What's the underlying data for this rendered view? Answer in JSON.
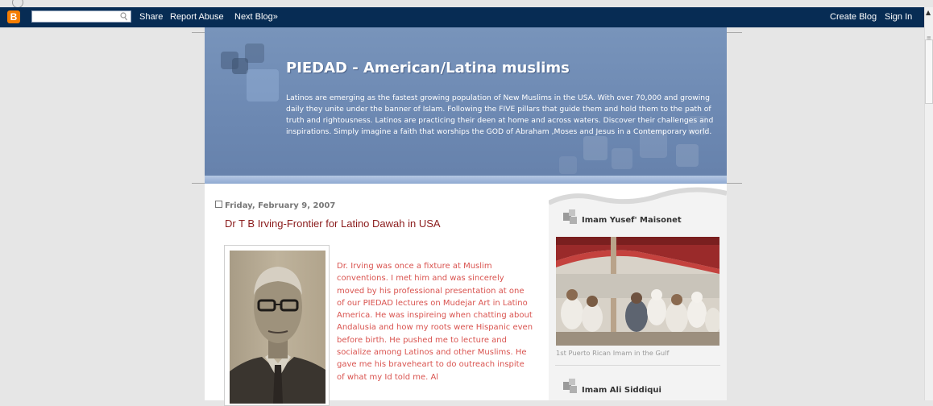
{
  "navbar": {
    "logo": "B",
    "links_left": [
      "Share",
      "Report Abuse",
      "Next Blog»"
    ],
    "links_right": [
      "Create Blog",
      "Sign In"
    ],
    "search_placeholder": ""
  },
  "header": {
    "title": "PIEDAD - American/Latina muslims",
    "description": "Latinos are emerging as the fastest growing population of New Muslims in the USA. With over 70,000 and growing daily they unite under the banner of Islam. Following the FIVE pillars that guide them and hold them to the path of truth and rightousness. Latinos are practicing their deen at home and across waters. Discover their challenges and inspirations. Simply imagine a faith that worships the GOD of Abraham ,Moses and Jesus in a Contemporary world."
  },
  "post": {
    "date": "Friday, February 9, 2007",
    "title": "Dr T B Irving-Frontier for Latino Dawah in USA",
    "body": "Dr. Irving was once a fixture at Muslim conventions. I met him and was sincerely moved by his professional presentation at one of our PIEDAD lectures on Mudejar Art in Latino America. He was inspireing when chatting about Andalusia and how my roots were Hispanic even before birth. He pushed me to lecture and socialize among Latinos and other Muslims. He gave me his braveheart to do outreach inspite of what my Id told me. Al"
  },
  "sidebar": {
    "widgets": [
      {
        "title": "Imam Yusef' Maisonet",
        "caption": "1st Puerto Rican Imam in the Gulf"
      },
      {
        "title": "Imam Ali Siddiqui"
      }
    ]
  },
  "colors": {
    "navbar_bg": "#072c54",
    "header_bg": "#6f8bb4",
    "post_title": "#8b1c1c",
    "post_body": "#d9534f",
    "page_bg": "#e6e6e6"
  },
  "icons": [
    "blogger-logo-icon",
    "search-icon",
    "square-bullet-icon",
    "widget-squares-icon"
  ]
}
